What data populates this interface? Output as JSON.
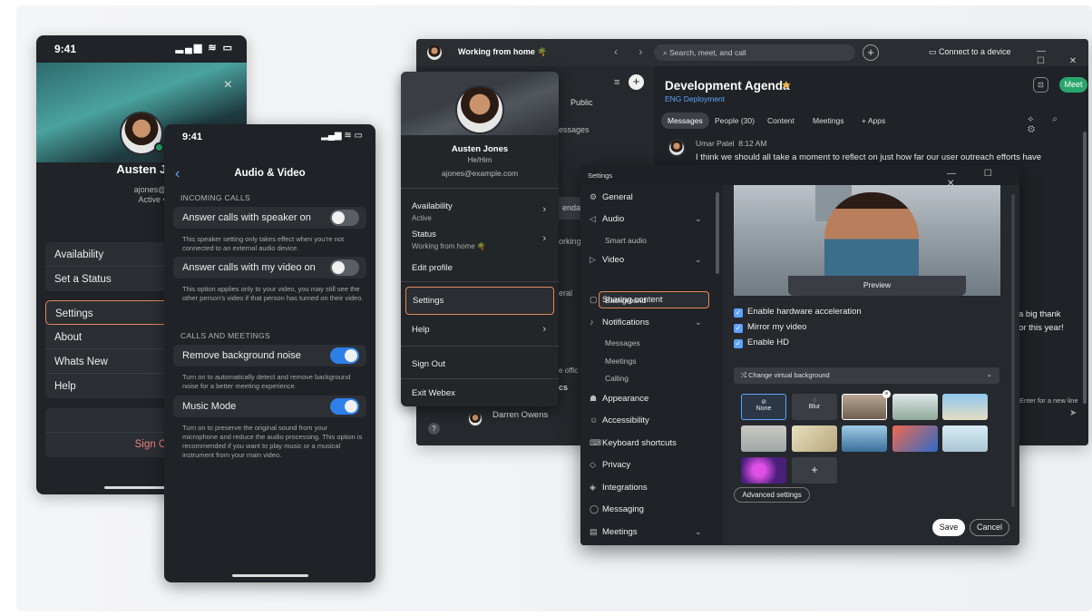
{
  "phone1": {
    "time": "9:41",
    "status_icons": "▂▄▆ ≋ ▭",
    "close_icon": "×",
    "name": "Austen Jones",
    "email": "ajones@example.c",
    "active": "Active • Working Rem",
    "group1": [
      "Availability",
      "Set a Status"
    ],
    "group2": [
      "Settings",
      "About",
      "Whats New",
      "Help"
    ],
    "group3": [
      "Send Feedba",
      "Send Logs"
    ],
    "sign_out": "Sign Out"
  },
  "phone2": {
    "time": "9:41",
    "status_icons": "▂▄▆ ≋ ▭",
    "back_icon": "‹",
    "title": "Audio & Video",
    "section_incoming": "INCOMING CALLS",
    "speaker_label": "Answer calls with speaker on",
    "speaker_note": "This speaker setting only takes effect when you're not connected to an external audio device.",
    "video_label": "Answer calls with my video on",
    "video_note": "This option applies only to your video, you may still see the other person's video if that person has turned on their video.",
    "section_calls": "CALLS AND MEETINGS",
    "noise_label": "Remove background noise",
    "noise_note": "Turn on to automatically detect and remove background noise for a better meeting experience.",
    "music_label": "Music Mode",
    "music_note": "Turn on to preserve the original sound from your microphone and reduce the audio processing. This option is recommended if you want to play music or a musical instrument from your main video.",
    "toggles": {
      "speaker": false,
      "video": false,
      "noise": true,
      "music": true
    }
  },
  "desktop": {
    "status": "Working from home 🌴",
    "nav": "‹ ›",
    "search_placeholder": "Search, meet, and call",
    "new_icon": "+",
    "connect": "Connect to a device",
    "window_controls": "— ☐ ✕",
    "left_fragments": {
      "public": "Public",
      "messages": "essages",
      "agenda": "enda",
      "working": "orking",
      "eral": "eral",
      "office": "e offic",
      "cs": "cs"
    },
    "left_contact": "Darren Owens",
    "left_icons": {
      "filter": "≡",
      "add": "+",
      "help": "?"
    },
    "space_title": "Development Agenda",
    "star": "★",
    "space_sub": "ENG Deployment",
    "meet": "Meet",
    "tabs": [
      "Messages",
      "People (30)",
      "Content",
      "Meetings",
      "+ Apps"
    ],
    "right_tools": "⟡ ⌕ ⚙",
    "message_author": "Umar Patel",
    "message_time": "8:12 AM",
    "message_text": "I think we should all take a moment to reflect on just how far our user outreach efforts have",
    "msg_frag1": "a big thank",
    "msg_frag2": "or this year!",
    "enter_hint": "Enter for a new line",
    "send_icon": "➤"
  },
  "dropdown": {
    "name": "Austen Jones",
    "pronouns": "He/Him",
    "email": "ajones@example.com",
    "availability": "Availability",
    "availability_sub": "Active",
    "status": "Status",
    "status_sub": "Working from home 🌴",
    "edit_profile": "Edit profile",
    "settings": "Settings",
    "help": "Help",
    "sign_out": "Sign Out",
    "exit": "Exit Webex",
    "chevron": "›"
  },
  "settings": {
    "title": "Settings",
    "window_controls": "— ☐ ✕",
    "nav": [
      {
        "label": "General",
        "icon": "⚙"
      },
      {
        "label": "Audio",
        "icon": "◁"
      },
      {
        "label": "Video",
        "icon": "▷"
      },
      {
        "label": "Sharing content",
        "icon": "▢"
      },
      {
        "label": "Notifications",
        "icon": "♪"
      },
      {
        "label": "Appearance",
        "icon": "☗"
      },
      {
        "label": "Accessibility",
        "icon": "☺"
      },
      {
        "label": "Keyboard shortcuts",
        "icon": "⌨"
      },
      {
        "label": "Privacy",
        "icon": "◇"
      },
      {
        "label": "Integrations",
        "icon": "◈"
      },
      {
        "label": "Messaging",
        "icon": "◯"
      },
      {
        "label": "Meetings",
        "icon": "▤"
      }
    ],
    "sub_audio": "Smart audio",
    "sub_video": "Background",
    "sub_notifications": [
      "Messages",
      "Meetings",
      "Calling"
    ],
    "chevron": "⌄",
    "preview": "Preview",
    "checks": [
      "Enable hardware acceleration",
      "Mirror my video",
      "Enable HD"
    ],
    "check_mark": "✓",
    "change_bg": "⤭ Change virtual background",
    "bg_none": "None",
    "bg_blur": "Blur",
    "add_bg": "+",
    "advanced": "Advanced settings",
    "save": "Save",
    "cancel": "Cancel"
  }
}
